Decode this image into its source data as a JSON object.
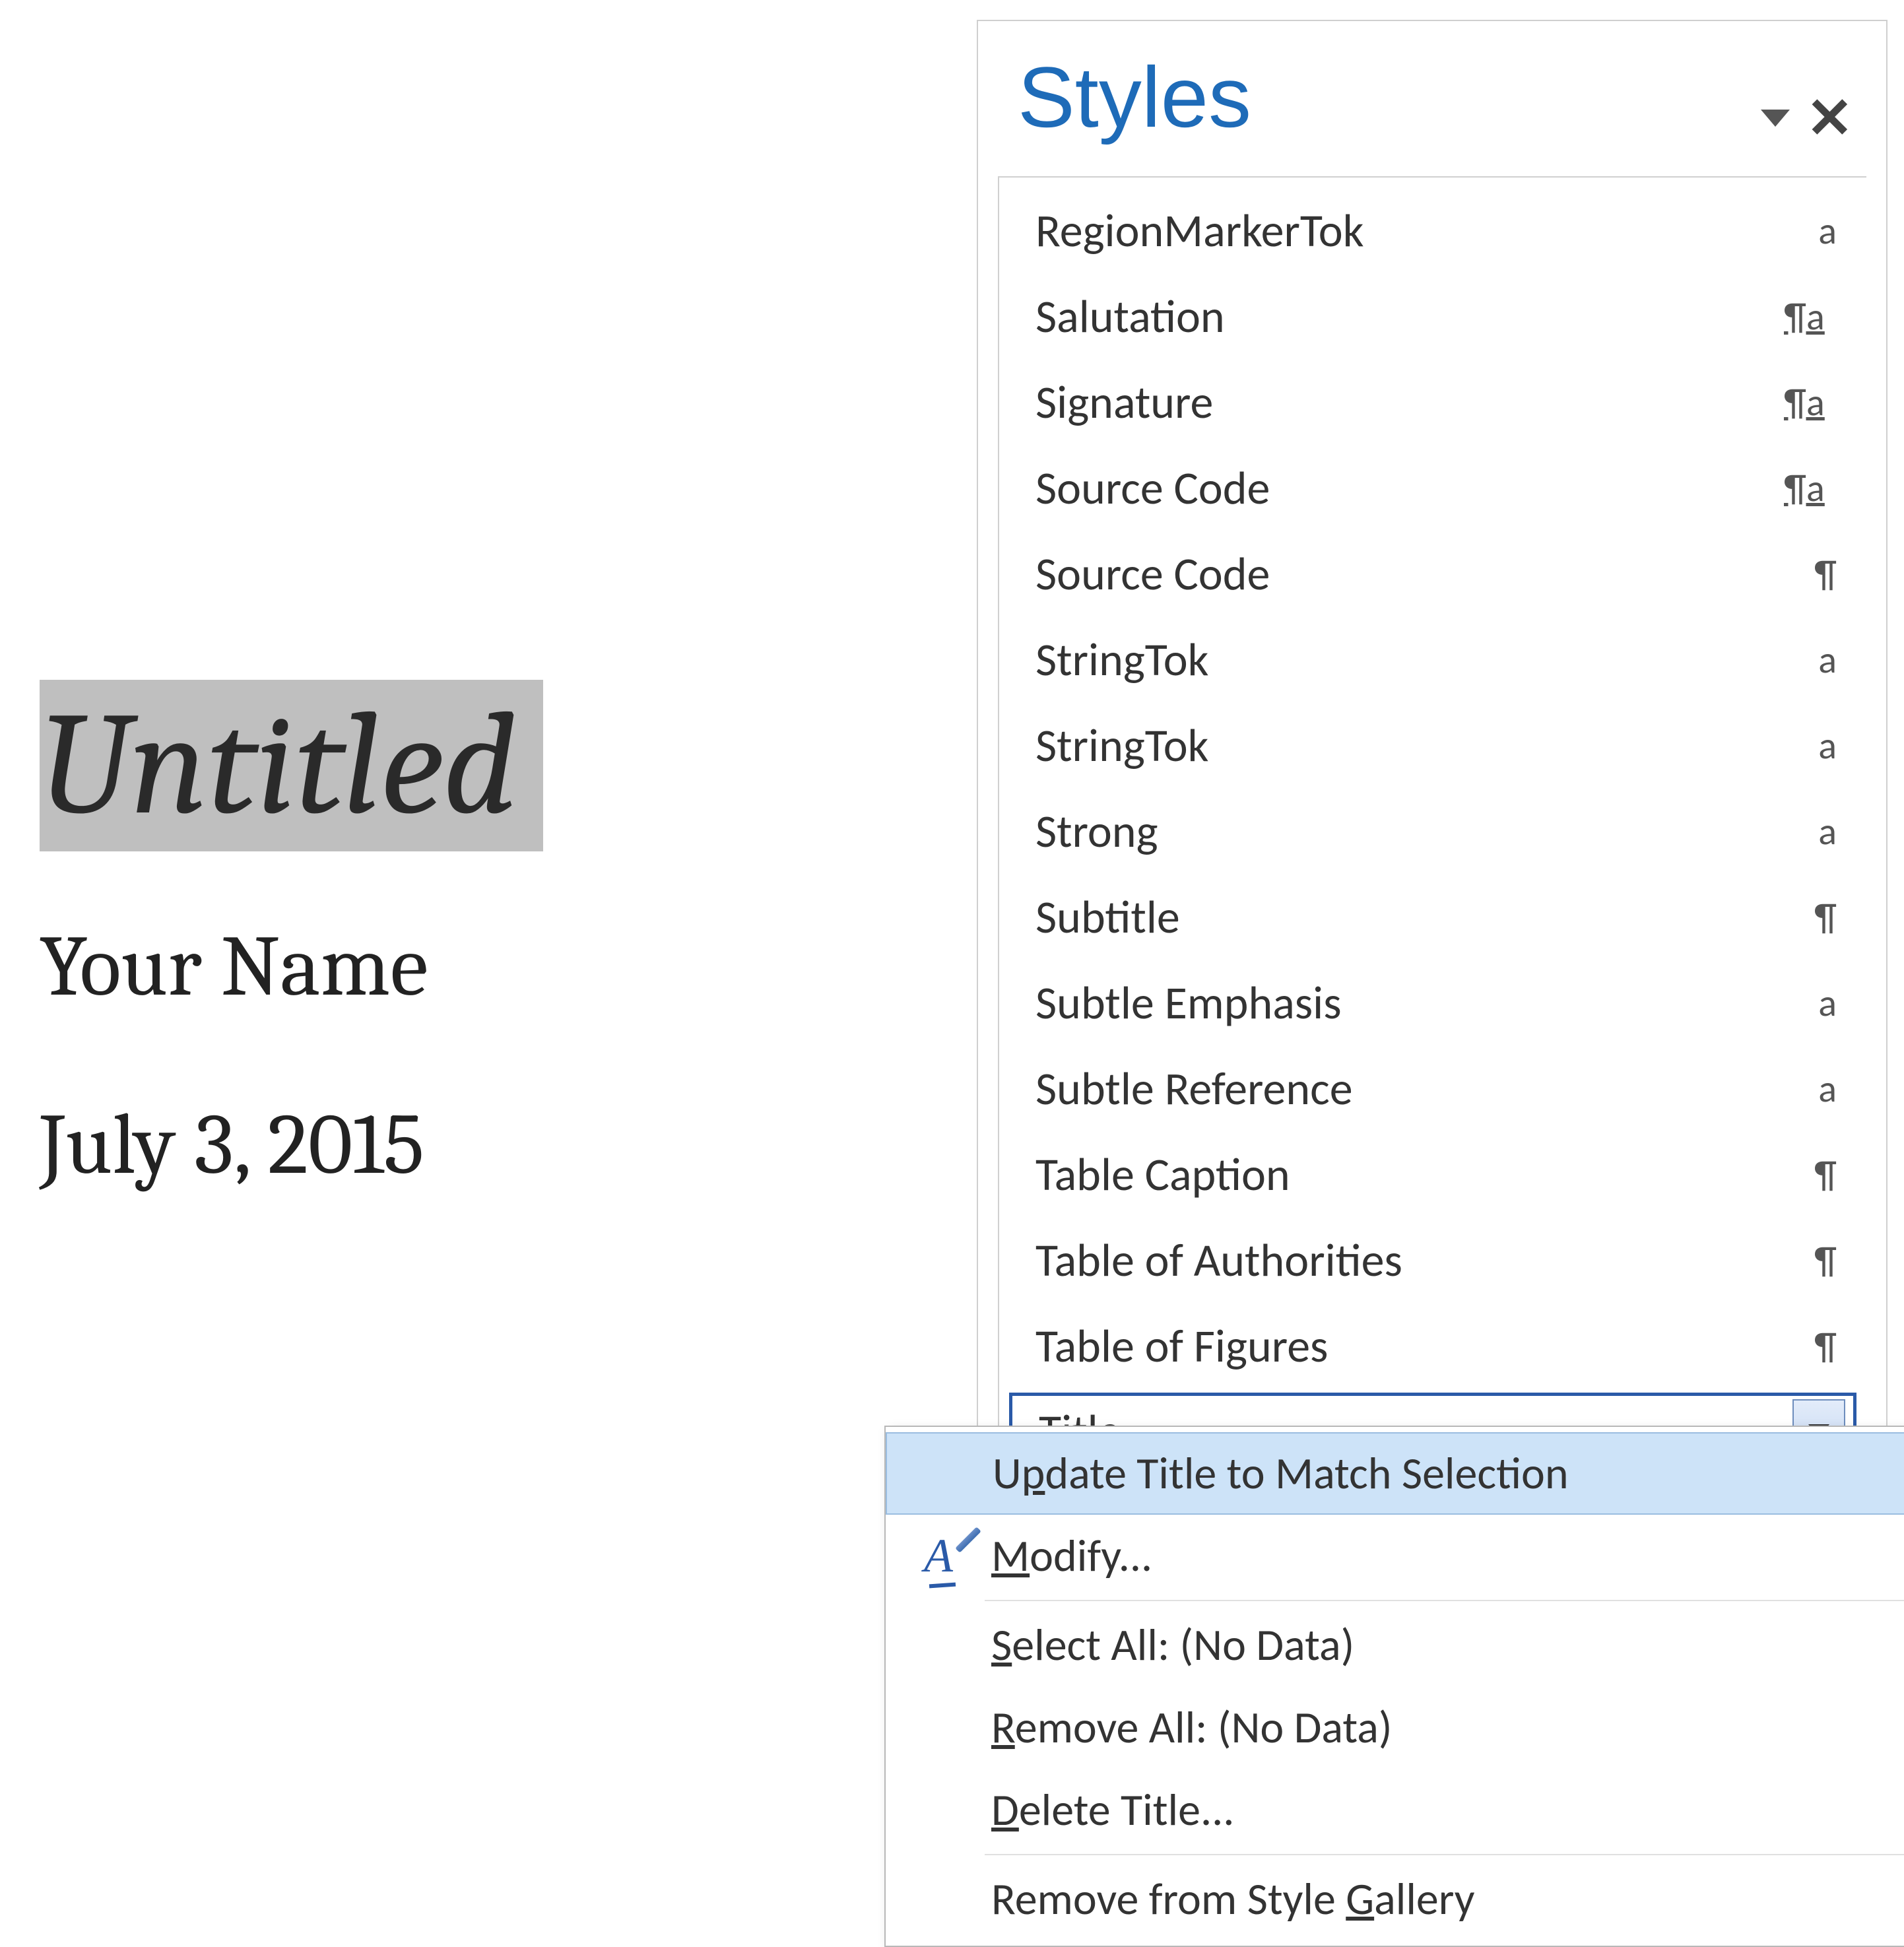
{
  "document": {
    "title": "Untitled",
    "author": "Your Name",
    "date": "July 3, 2015"
  },
  "styles_pane": {
    "title": "Styles",
    "items": [
      {
        "name": "RegionMarkerTok",
        "type": "char"
      },
      {
        "name": "Salutation",
        "type": "linked"
      },
      {
        "name": "Signature",
        "type": "linked"
      },
      {
        "name": "Source Code",
        "type": "linked"
      },
      {
        "name": "Source Code",
        "type": "para"
      },
      {
        "name": "StringTok",
        "type": "char"
      },
      {
        "name": "StringTok",
        "type": "char"
      },
      {
        "name": "Strong",
        "type": "char"
      },
      {
        "name": "Subtitle",
        "type": "para"
      },
      {
        "name": "Subtle Emphasis",
        "type": "char"
      },
      {
        "name": "Subtle Reference",
        "type": "char"
      },
      {
        "name": "Table Caption",
        "type": "para"
      },
      {
        "name": "Table of Authorities",
        "type": "para"
      },
      {
        "name": "Table of Figures",
        "type": "para"
      }
    ],
    "selected": {
      "name": "Title"
    }
  },
  "context_menu": {
    "items": [
      {
        "pre": "U",
        "mid": "p",
        "post": "date Title to Match Selection",
        "icon": "",
        "highlight": true
      },
      {
        "pre": "",
        "mid": "M",
        "post": "odify...",
        "icon": "pencil",
        "highlight": false
      },
      {
        "separator": true
      },
      {
        "pre": "",
        "mid": "S",
        "post": "elect All: (No Data)",
        "icon": "",
        "highlight": false
      },
      {
        "pre": "",
        "mid": "R",
        "post": "emove All: (No Data)",
        "icon": "",
        "highlight": false
      },
      {
        "pre": "",
        "mid": "D",
        "post": "elete Title...",
        "icon": "",
        "highlight": false
      },
      {
        "separator": true
      },
      {
        "pre": "Remove from Style ",
        "mid": "G",
        "post": "allery",
        "icon": "",
        "highlight": false
      }
    ]
  }
}
